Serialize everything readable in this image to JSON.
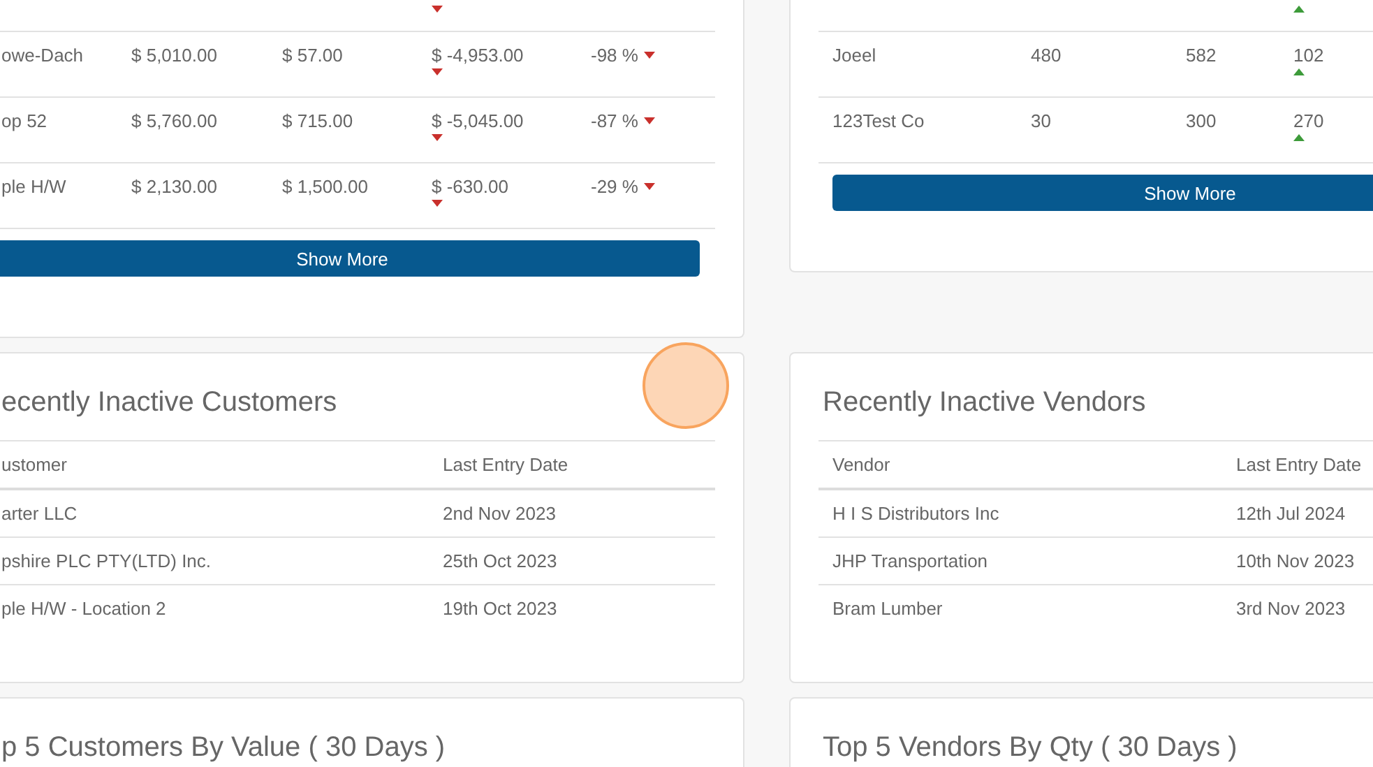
{
  "panels": [
    {
      "kind": "comparison",
      "rows": [
        {
          "declining": true
        },
        {
          "cells": [
            "owe-Dach",
            "$ 5,010.00",
            "$ 57.00",
            "$ -4,953.00",
            "-98 %"
          ],
          "declining": true
        },
        {
          "cells": [
            "op 52",
            "$ 5,760.00",
            "$ 715.00",
            "$ -5,045.00",
            "-87 %"
          ],
          "declining": true
        },
        {
          "cells": [
            "ple H/W",
            "$ 2,130.00",
            "$ 1,500.00",
            "$ -630.00",
            "-29 %"
          ],
          "declining": true
        }
      ],
      "button": "Show More"
    },
    {
      "kind": "comparison",
      "rows": [
        {
          "declining": false
        },
        {
          "cells": [
            "Joeel",
            "480",
            "582",
            "102"
          ],
          "declining": false
        },
        {
          "cells": [
            "123Test Co",
            "30",
            "300",
            "270"
          ],
          "declining": false
        }
      ],
      "button": "Show More"
    },
    {
      "kind": "list",
      "title": "ecently Inactive Customers",
      "columns": [
        "ustomer",
        "Last Entry Date"
      ],
      "rows": [
        [
          "arter LLC",
          "2nd Nov 2023"
        ],
        [
          "pshire PLC PTY(LTD) Inc.",
          "25th Oct 2023"
        ],
        [
          "ple H/W - Location 2",
          "19th Oct 2023"
        ]
      ]
    },
    {
      "kind": "list",
      "title": "Recently Inactive Vendors",
      "columns": [
        "Vendor",
        "Last Entry Date"
      ],
      "rows": [
        [
          "H I S Distributors Inc",
          "12th Jul 2024"
        ],
        [
          "JHP Transportation",
          "10th Nov 2023"
        ],
        [
          "Bram Lumber",
          "3rd Nov 2023"
        ]
      ]
    },
    {
      "kind": "title_only",
      "title": "p 5 Customers By Value ( 30 Days )"
    },
    {
      "kind": "title_only",
      "title": "Top 5 Vendors By Qty ( 30 Days )"
    }
  ],
  "click_marker": true
}
